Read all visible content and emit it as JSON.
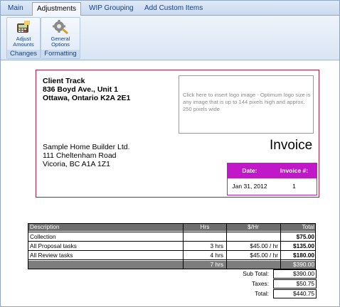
{
  "tabs": [
    {
      "label": "Main"
    },
    {
      "label": "Adjustments"
    },
    {
      "label": "WIP Grouping"
    },
    {
      "label": "Add Custom Items"
    }
  ],
  "ribbon": {
    "changes_group": {
      "caption": "Changes",
      "button_line1": "Adjust",
      "button_line2": "Amounts"
    },
    "formatting_group": {
      "caption": "Formatting",
      "button_line1": "General",
      "button_line2": "Options"
    }
  },
  "invoice": {
    "company_lines": [
      "Client Track",
      "836 Boyd Ave., Unit 1",
      "Ottawa, Ontario  K2A 2E1"
    ],
    "logo_placeholder": "Click here to insert logo image - Optimum logo size is any image that is up to 144 pixels high and approx. 250 pixels wide",
    "client_lines": [
      "Sample Home Builder Ltd.",
      "111 Cheltenham Road",
      "Vicoria, BC  A1A 1Z1"
    ],
    "title": "Invoice",
    "date_header": "Date:",
    "number_header": "Invoice #:",
    "date_value": "Jan 31, 2012",
    "number_value": "1"
  },
  "items_table": {
    "columns": [
      "Description",
      "Hrs",
      "$/Hr",
      "Total"
    ],
    "rows": [
      {
        "description": "Collection",
        "hrs": "",
        "rate": "",
        "total": "$75.00"
      },
      {
        "description": "All Proposal tasks",
        "hrs": "3 hrs",
        "rate": "$45.00 / hr",
        "total": "$135.00"
      },
      {
        "description": "All Review tasks",
        "hrs": "4 hrs",
        "rate": "$45.00 / hr",
        "total": "$180.00"
      }
    ],
    "footer": {
      "hrs": "7 hrs",
      "total": "$390.00"
    },
    "totals": [
      {
        "label": "Sub Total:",
        "value": "$390.00"
      },
      {
        "label": "Taxes:",
        "value": "$50.75"
      },
      {
        "label": "Total:",
        "value": "$440.75"
      }
    ]
  },
  "colors": {
    "accent_border": "#b01c3c",
    "meta_header": "#c018c8",
    "ribbon_text": "#15428b"
  }
}
